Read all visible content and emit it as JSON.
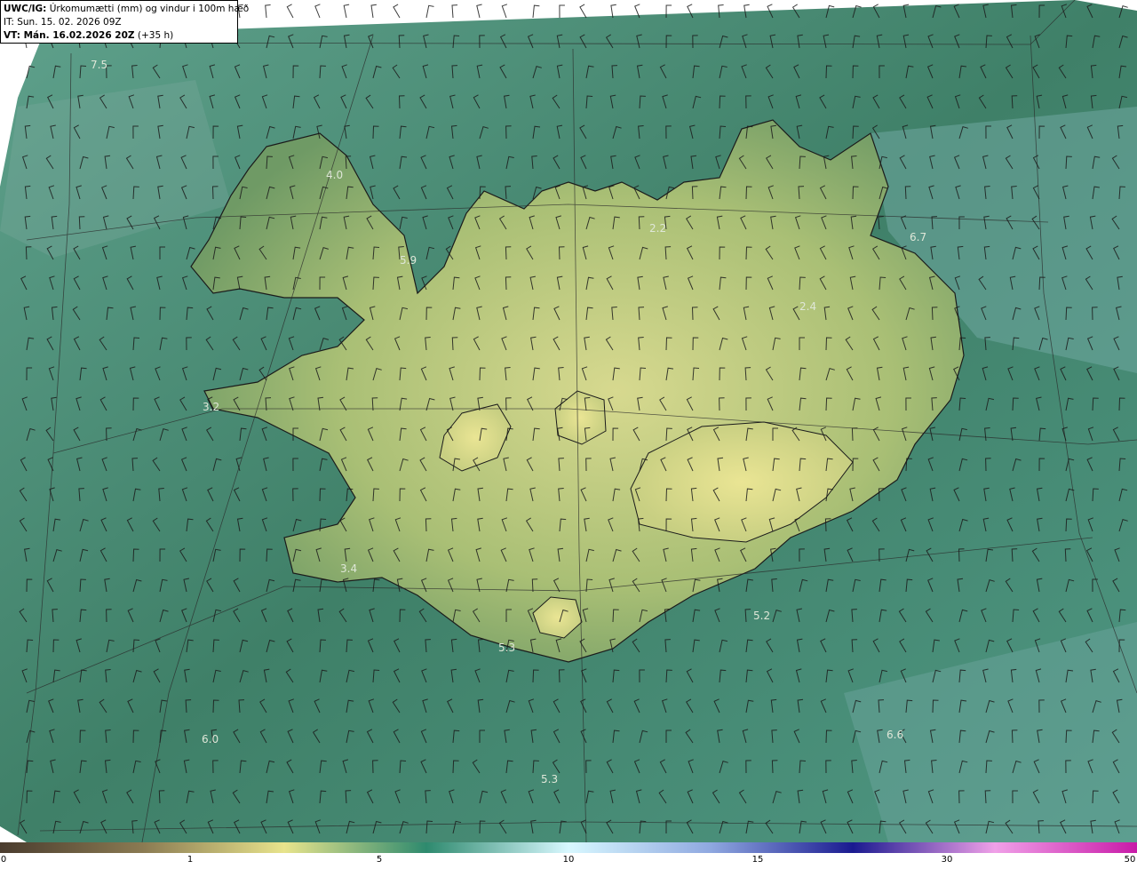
{
  "header": {
    "model": "UWC/IG:",
    "title": "Úrkomumætti (mm) og vindur i 100m hæð",
    "issue_time": "IT: Sun. 15. 02. 2026 09Z",
    "valid_prefix": "VT: Mán. 16.02.2026 20Z",
    "valid_suffix": " (+35 h)"
  },
  "value_labels": [
    "7.5",
    "4.0",
    "5.9",
    "2.2",
    "6.7",
    "2.4",
    "3.2",
    "3.4",
    "5.2",
    "5.3",
    "6.0",
    "6.6",
    "5.3"
  ],
  "colorbar": {
    "ticks": [
      "0",
      "1",
      "5",
      "10",
      "15",
      "30",
      "50"
    ],
    "stops": [
      "#4a3c2e",
      "#8a7a52",
      "#e8e48c",
      "#2e8a6e",
      "#d8f8ff",
      "#8fa8e0",
      "#1a1a90",
      "#f0a0e8",
      "#c81aa8"
    ]
  },
  "colors": {
    "sea_dark": "#2f6f5a",
    "sea_mid": "#4d8f79",
    "land_light": "#c9d28a",
    "land_mid": "#8fb06b",
    "barb": "#1b1b1b"
  }
}
